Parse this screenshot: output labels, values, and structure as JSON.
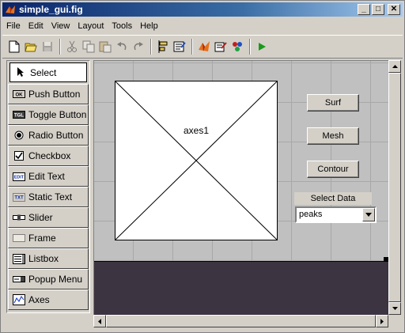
{
  "window": {
    "title": "simple_gui.fig",
    "controls": {
      "minimize": "_",
      "maximize": "□",
      "close": "✕"
    }
  },
  "menu": [
    "File",
    "Edit",
    "View",
    "Layout",
    "Tools",
    "Help"
  ],
  "toolbar": {
    "icons": [
      "new-file-icon",
      "open-folder-icon",
      "save-icon",
      "cut-icon",
      "copy-icon",
      "paste-icon",
      "undo-icon",
      "redo-icon",
      "align-objects-icon",
      "menu-editor-icon",
      "tab-order-editor-icon",
      "m-file-editor-icon",
      "property-inspector-icon",
      "object-browser-icon",
      "run-icon"
    ]
  },
  "palette": {
    "items": [
      {
        "label": "Select",
        "icon": "arrow-pointer-icon",
        "selected": true
      },
      {
        "label": "Push Button",
        "icon": "push-button-icon"
      },
      {
        "label": "Toggle Button",
        "icon": "toggle-button-icon"
      },
      {
        "label": "Radio Button",
        "icon": "radio-button-icon"
      },
      {
        "label": "Checkbox",
        "icon": "checkbox-icon"
      },
      {
        "label": "Edit Text",
        "icon": "edit-text-icon"
      },
      {
        "label": "Static Text",
        "icon": "static-text-icon"
      },
      {
        "label": "Slider",
        "icon": "slider-icon"
      },
      {
        "label": "Frame",
        "icon": "frame-icon"
      },
      {
        "label": "Listbox",
        "icon": "listbox-icon"
      },
      {
        "label": "Popup Menu",
        "icon": "popup-menu-icon"
      },
      {
        "label": "Axes",
        "icon": "axes-icon"
      }
    ],
    "icon_text": {
      "push": "OK",
      "toggle": "TGL",
      "edit": "EDIT",
      "static": "TXT"
    }
  },
  "canvas": {
    "axes_label": "axes1",
    "buttons": {
      "surf": "Surf",
      "mesh": "Mesh",
      "contour": "Contour"
    },
    "select_label": "Select Data",
    "popup_value": "peaks"
  },
  "colors": {
    "title_bar": "#0a246a",
    "face": "#d4d0c8",
    "grid_bg": "#c0c0c0",
    "figure_bottom": "#3c3440",
    "run_green": "#1a9a1a"
  }
}
